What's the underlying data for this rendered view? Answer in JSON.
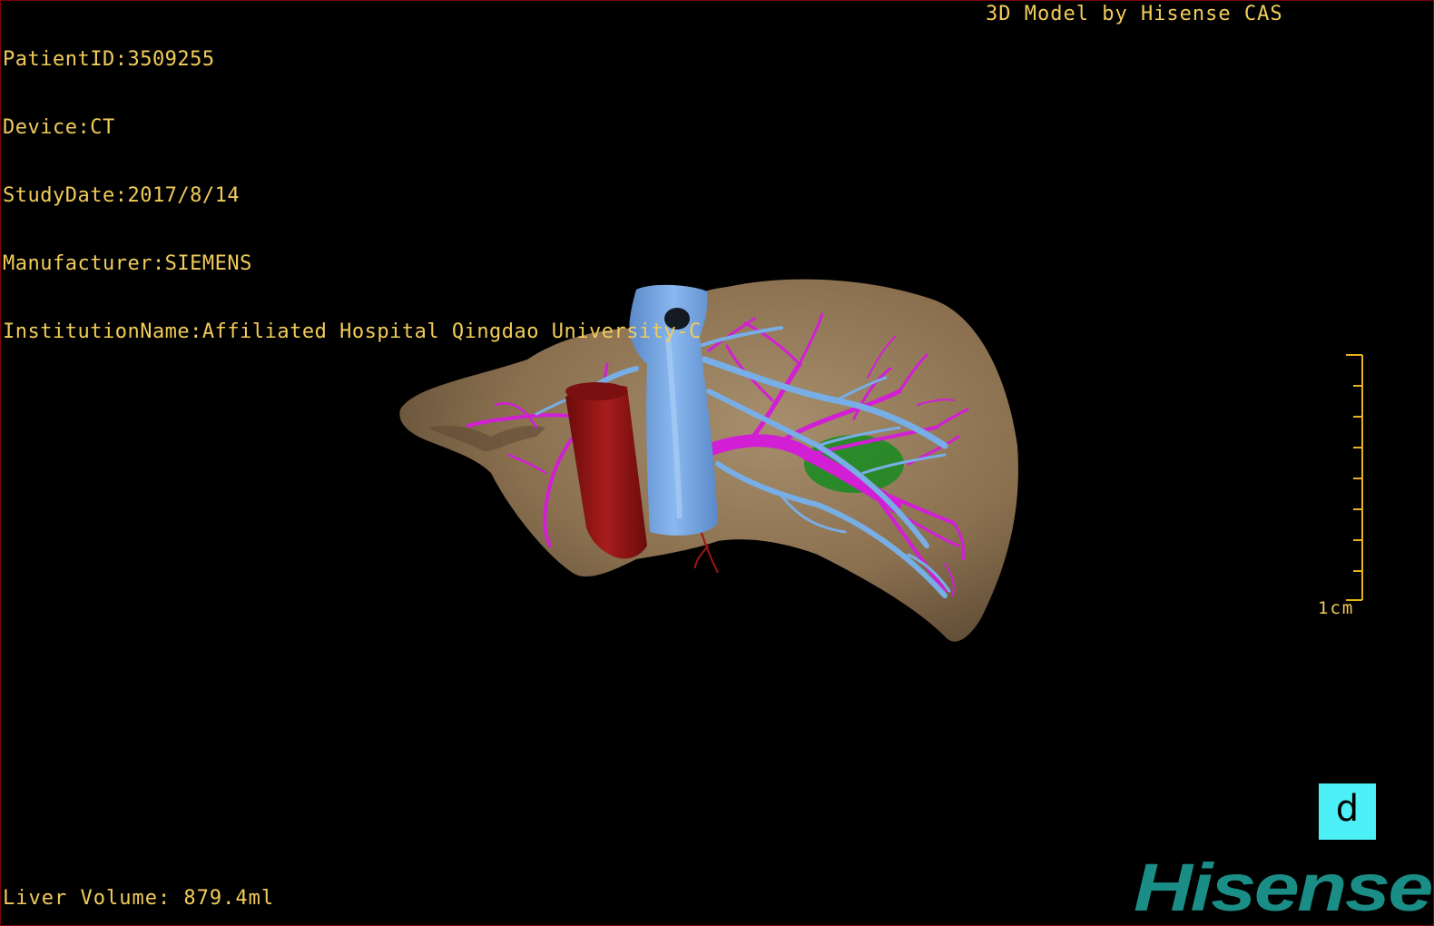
{
  "patient": {
    "patient_id": "PatientID:3509255",
    "device": "Device:CT",
    "study_date": "StudyDate:2017/8/14",
    "manufacturer": "Manufacturer:SIEMENS",
    "institution": "InstitutionName:Affiliated Hospital Qingdao University-C"
  },
  "credit": "3D Model by Hisense CAS",
  "liver_volume": "Liver Volume: 879.4ml",
  "scale_bar": {
    "label": "1cm"
  },
  "orientation_button": {
    "label": "d"
  },
  "brand": {
    "logo_text": "Hisense"
  },
  "colors": {
    "overlay_text": "#f2cc5a",
    "liver": "#8c7355",
    "hepatic_vein": "#6ea3e0",
    "portal_vein": "#d21fd6",
    "aorta": "#8e1414",
    "tumor": "#1e8a24",
    "orientation_button": "#4cf0f6",
    "logo": "#1a8e86",
    "border": "#7a0010"
  },
  "icons": [
    "orientation-cube-icon",
    "hisense-logo"
  ]
}
